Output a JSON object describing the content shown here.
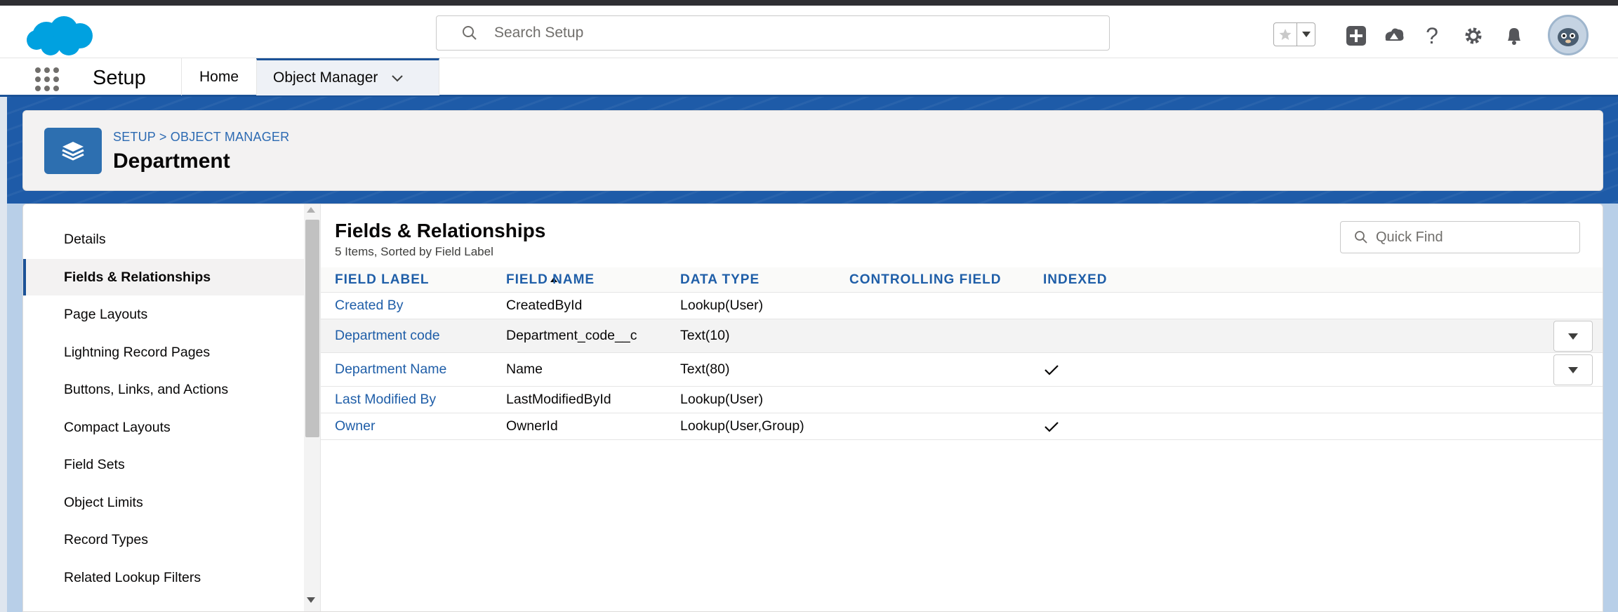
{
  "header": {
    "search_placeholder": "Search Setup",
    "icons": [
      "favorites-star-icon",
      "favorites-menu-icon",
      "global-add-icon",
      "trailhead-icon",
      "help-icon",
      "setup-gear-icon",
      "notifications-bell-icon"
    ],
    "brand_color": "#00a1e0"
  },
  "context_bar": {
    "app_name": "Setup",
    "tabs": [
      {
        "label": "Home"
      },
      {
        "label": "Object Manager"
      }
    ]
  },
  "page_header": {
    "breadcrumb": "SETUP > OBJECT MANAGER",
    "title": "Department"
  },
  "sidebar": {
    "items": [
      {
        "label": "Details"
      },
      {
        "label": "Fields & Relationships"
      },
      {
        "label": "Page Layouts"
      },
      {
        "label": "Lightning Record Pages"
      },
      {
        "label": "Buttons, Links, and Actions"
      },
      {
        "label": "Compact Layouts"
      },
      {
        "label": "Field Sets"
      },
      {
        "label": "Object Limits"
      },
      {
        "label": "Record Types"
      },
      {
        "label": "Related Lookup Filters"
      }
    ],
    "active_index": 1
  },
  "content": {
    "title": "Fields & Relationships",
    "subtitle": "5 Items, Sorted by Field Label",
    "quick_find_placeholder": "Quick Find",
    "columns": [
      "FIELD LABEL",
      "FIELD NAME",
      "DATA TYPE",
      "CONTROLLING FIELD",
      "INDEXED"
    ],
    "rows": [
      {
        "label": "Created By",
        "name": "CreatedById",
        "type": "Lookup(User)",
        "controlling": "",
        "indexed": false,
        "menu": false
      },
      {
        "label": "Department code",
        "name": "Department_code__c",
        "type": "Text(10)",
        "controlling": "",
        "indexed": false,
        "menu": true
      },
      {
        "label": "Department Name",
        "name": "Name",
        "type": "Text(80)",
        "controlling": "",
        "indexed": true,
        "menu": true
      },
      {
        "label": "Last Modified By",
        "name": "LastModifiedById",
        "type": "Lookup(User)",
        "controlling": "",
        "indexed": false,
        "menu": false
      },
      {
        "label": "Owner",
        "name": "OwnerId",
        "type": "Lookup(User,Group)",
        "controlling": "",
        "indexed": true,
        "menu": false
      }
    ]
  },
  "colors": {
    "link": "#1f5ea8",
    "band": "#1e5ba8",
    "object_icon": "#2d6fb0"
  }
}
